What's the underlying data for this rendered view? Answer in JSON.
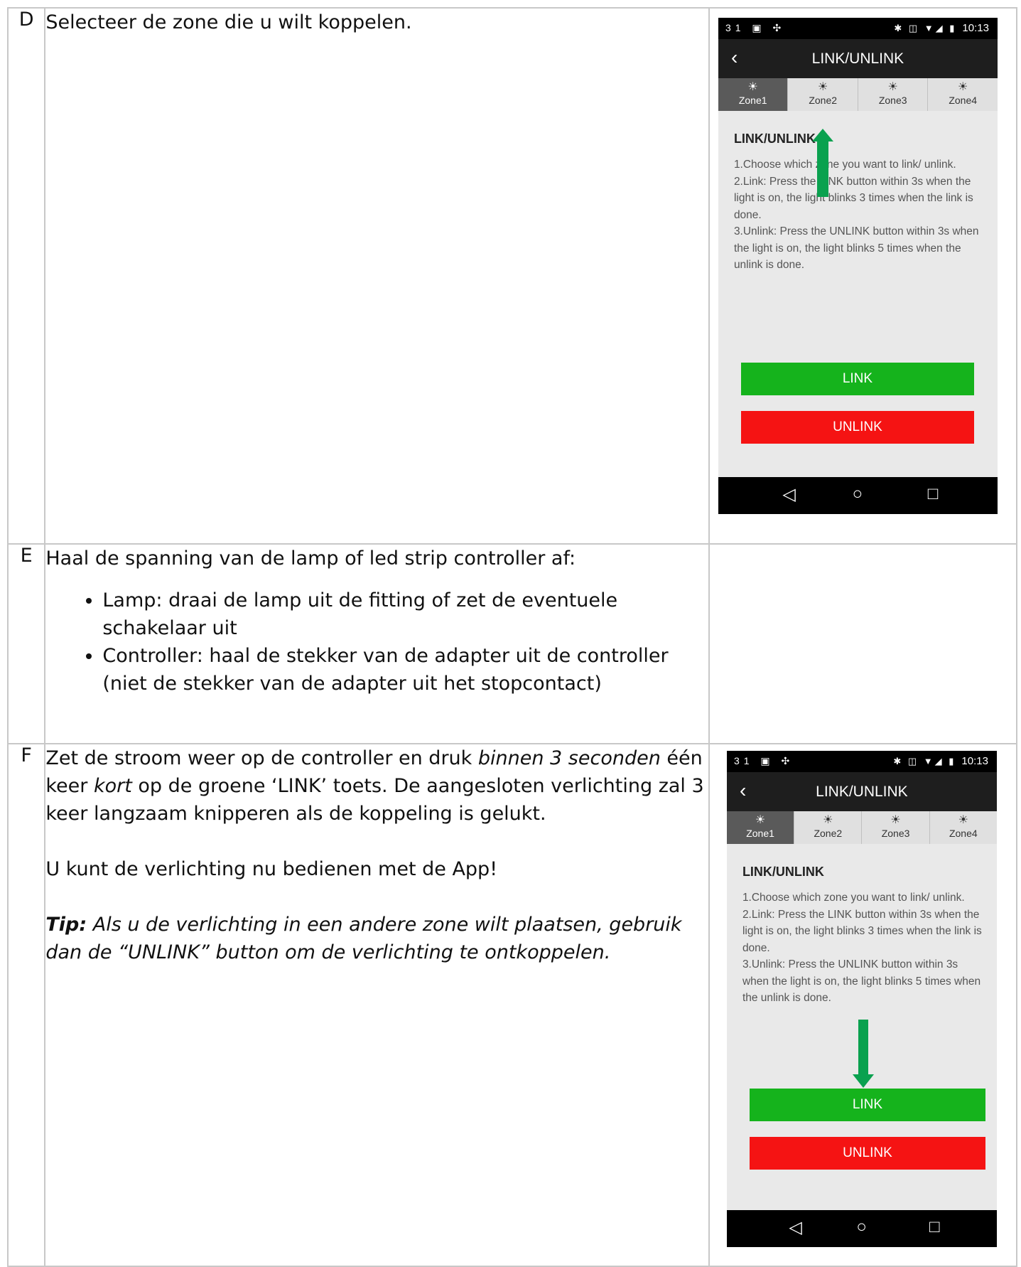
{
  "rows": [
    {
      "letter": "D",
      "text": "Selecteer de zone die u wilt koppelen."
    },
    {
      "letter": "E",
      "intro": "Haal de spanning van de lamp of led strip controller af:",
      "bullets": [
        "Lamp: draai de lamp uit de fitting of zet de eventuele schakelaar uit",
        "Controller: haal de stekker van de adapter uit de controller (niet de stekker van de adapter uit het stopcontact)"
      ]
    },
    {
      "letter": "F",
      "p1_a": "Zet de stroom weer op de controller en druk ",
      "p1_em1": "binnen 3 seconden",
      "p1_b": " één keer ",
      "p1_em2": "kort",
      "p1_c": " op de groene ‘LINK’ toets. De aangesloten verlichting zal 3 keer langzaam knipperen als de koppeling is gelukt.",
      "p2": "U kunt de verlichting nu bedienen met de App!",
      "tip_label": "Tip:",
      "tip_text": " Als u de verlichting in een andere zone wilt plaatsen, gebruik dan de “UNLINK” button om de verlichting te ontkoppelen."
    }
  ],
  "phone": {
    "status_left": "31 ▣ ✣",
    "status_icons": "✱ ◫ ▼◢ ▮",
    "time": "10:13",
    "title": "LINK/UNLINK",
    "back": "‹",
    "tabs": [
      "Zone1",
      "Zone2",
      "Zone3",
      "Zone4"
    ],
    "sun": "☀",
    "heading": "LINK/UNLINK",
    "instructions": "1.Choose which zone you want to link/ unlink.\n2.Link: Press the LINK button within 3s when the light is on, the light blinks 3 times when the link is done.\n3.Unlink: Press the UNLINK button within 3s when the light is on, the light blinks 5 times when the unlink is done.",
    "link_label": "LINK",
    "unlink_label": "UNLINK",
    "nav_back": "◁",
    "nav_home": "○",
    "nav_recent": "□",
    "colors": {
      "link": "#15b31c",
      "unlink": "#f51313",
      "arrow": "#0aa14f"
    }
  }
}
